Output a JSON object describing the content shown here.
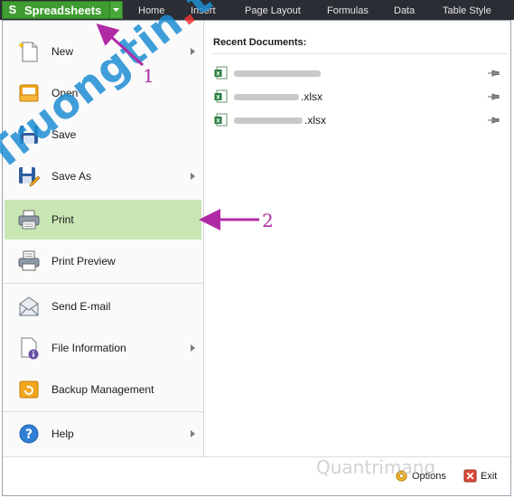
{
  "app": {
    "title": "Spreadsheets",
    "logo_glyph": "S",
    "accent_color": "#3f9c31"
  },
  "tabs": [
    {
      "label": "Home"
    },
    {
      "label": "Insert"
    },
    {
      "label": "Page Layout"
    },
    {
      "label": "Formulas"
    },
    {
      "label": "Data"
    },
    {
      "label": "Table Style"
    }
  ],
  "menu": {
    "items": [
      {
        "label": "New",
        "icon": "new-document-icon",
        "has_submenu": true
      },
      {
        "label": "Open",
        "icon": "open-folder-icon",
        "has_submenu": false
      },
      {
        "label": "Save",
        "icon": "save-disk-icon",
        "has_submenu": false
      },
      {
        "label": "Save As",
        "icon": "save-as-icon",
        "has_submenu": true
      },
      {
        "label": "Print",
        "icon": "printer-icon",
        "has_submenu": false,
        "selected": true
      },
      {
        "label": "Print Preview",
        "icon": "print-preview-icon",
        "has_submenu": false
      },
      {
        "label": "Send E-mail",
        "icon": "email-icon",
        "has_submenu": false
      },
      {
        "label": "File Information",
        "icon": "file-info-icon",
        "has_submenu": true
      },
      {
        "label": "Backup Management",
        "icon": "backup-icon",
        "has_submenu": false
      },
      {
        "label": "Help",
        "icon": "help-icon",
        "has_submenu": true
      }
    ],
    "selected_color": "#c9e6b5"
  },
  "recent": {
    "title": "Recent Documents:",
    "documents": [
      {
        "name": "",
        "icon": "excel-file-icon"
      },
      {
        "name": ".xlsx",
        "icon": "excel-file-icon"
      },
      {
        "name": ".xlsx",
        "icon": "excel-file-icon"
      }
    ]
  },
  "bottom": {
    "options_label": "Options",
    "exit_label": "Exit"
  },
  "overlay": {
    "watermark_main": "Truongtin",
    "watermark_dot": ".",
    "watermark_tail": "top",
    "footer_mark": "Quantrimang",
    "annotation_1": "1",
    "annotation_2": "2",
    "annotation_color": "#b02aa6"
  }
}
